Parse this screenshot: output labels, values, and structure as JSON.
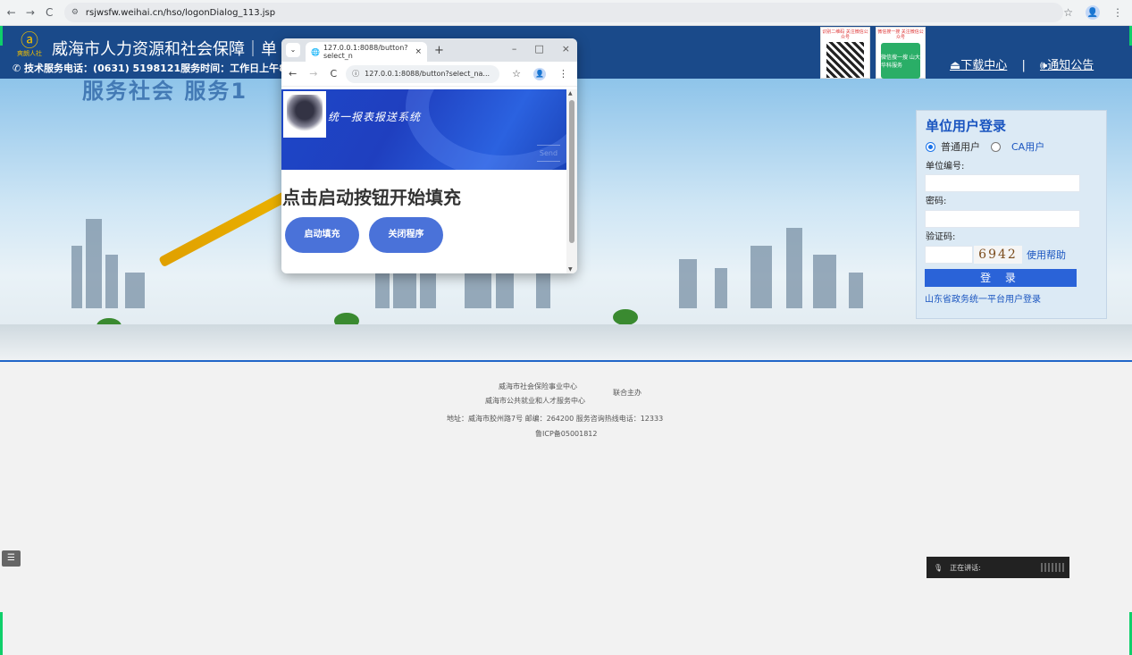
{
  "browser": {
    "url": "rsjwsfw.weihai.cn/hso/logonDialog_113.jsp",
    "back": "←",
    "forward": "→",
    "reload": "C",
    "star": "☆",
    "menu": "⋮"
  },
  "header": {
    "logo_text": "爽朗人社",
    "title": "威海市人力资源和社会保障｜单",
    "hotline": "技术服务电话：(0631) 5198121服务时间：工作日上午8：3",
    "qr1_caption": "识别二维码 关注微信公众号",
    "qr2_caption": "微信搜一搜 关注微信公众号",
    "qr2_inner": "微信搜一搜 山大华科服务",
    "download": "下载中心",
    "separator": "|",
    "notice": "通知公告"
  },
  "banner": {
    "slogan": "服务社会 服务1"
  },
  "login": {
    "title": "单位用户登录",
    "radio_normal": "普通用户",
    "radio_ca": "CA用户",
    "unit_label": "单位编号:",
    "password_label": "密码:",
    "captcha_label": "验证码:",
    "captcha_text": "6942",
    "help": "使用帮助",
    "login_button": "登 录",
    "gov_login": "山东省政务统一平台用户登录"
  },
  "footer": {
    "org1": "威海市社会保险事业中心",
    "org2": "威海市公共就业和人才服务中心",
    "co_host": "联合主办",
    "address": "地址：威海市胶州路7号 邮编：264200 服务咨询热线电话：12333",
    "icp": "鲁ICP备05001812"
  },
  "widgets": {
    "side_button": "☰",
    "speaking": "正在讲话:"
  },
  "popup": {
    "tab_title": "127.0.0.1:8088/button?select_n",
    "tab_close": "×",
    "new_tab": "+",
    "minimize": "–",
    "maximize": "□",
    "close": "×",
    "url": "127.0.0.1:8088/button?select_na...",
    "banner_title": "统一报表报送系统",
    "send": "Send",
    "heading": "点击启动按钮开始填充",
    "start_button": "启动填充",
    "close_button": "关闭程序"
  }
}
